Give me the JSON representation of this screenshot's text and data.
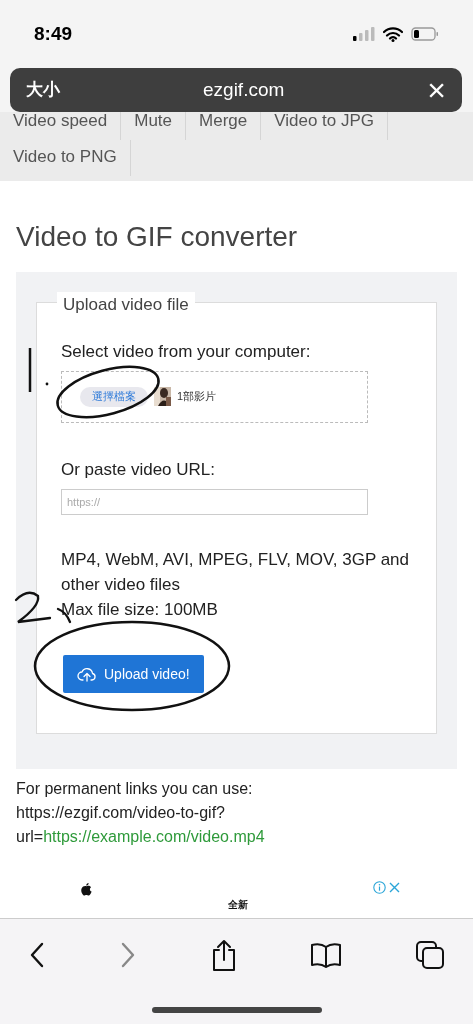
{
  "status_bar": {
    "time": "8:49"
  },
  "address_bar": {
    "text_size_button": "大小",
    "url": "ezgif.com",
    "close": "×"
  },
  "nav_tabs": [
    {
      "label": "Video speed"
    },
    {
      "label": "Mute"
    },
    {
      "label": "Merge"
    },
    {
      "label": "Video to JPG"
    },
    {
      "label": "Video to PNG"
    }
  ],
  "heading": "Video to GIF converter",
  "form": {
    "legend": "Upload video file",
    "file_label": "Select video from your computer:",
    "choose_button": "選擇檔案",
    "file_status": "1部影片",
    "url_label": "Or paste video URL:",
    "url_placeholder": "https://",
    "formats": "MP4, WebM, AVI, MPEG, FLV, MOV, 3GP and other video files",
    "max_size": "Max file size: 100MB",
    "upload_button": "Upload video!"
  },
  "permalink": {
    "text": "For permanent links you can use: https://ezgif.com/video-to-gif?url=",
    "link": "https://example.com/video.mp4"
  },
  "ad": {
    "tagline": "全新"
  }
}
